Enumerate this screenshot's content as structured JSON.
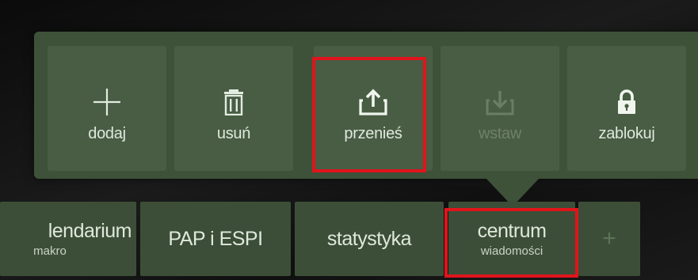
{
  "toolbar": {
    "items": [
      {
        "label": "dodaj",
        "icon": "plus-icon",
        "enabled": true
      },
      {
        "label": "usuń",
        "icon": "trash-icon",
        "enabled": true
      },
      {
        "label": "przenieś",
        "icon": "upload-icon",
        "enabled": true,
        "highlighted": true
      },
      {
        "label": "wstaw",
        "icon": "download-icon",
        "enabled": false
      },
      {
        "label": "zablokuj",
        "icon": "lock-icon",
        "enabled": true
      }
    ]
  },
  "tabs": {
    "items": [
      {
        "title": "lendarium",
        "subtitle": "makro"
      },
      {
        "title": "PAP i ESPI",
        "subtitle": ""
      },
      {
        "title": "statystyka",
        "subtitle": ""
      },
      {
        "title": "centrum",
        "subtitle": "wiadomości",
        "highlighted": true
      }
    ],
    "add_label": "+"
  },
  "colors": {
    "panel": "#3e5239",
    "tile": "#485d43",
    "tab": "#3c4e37",
    "highlight": "#e0141c",
    "text": "#dfe8dc",
    "disabled_text": "#6e8069"
  }
}
